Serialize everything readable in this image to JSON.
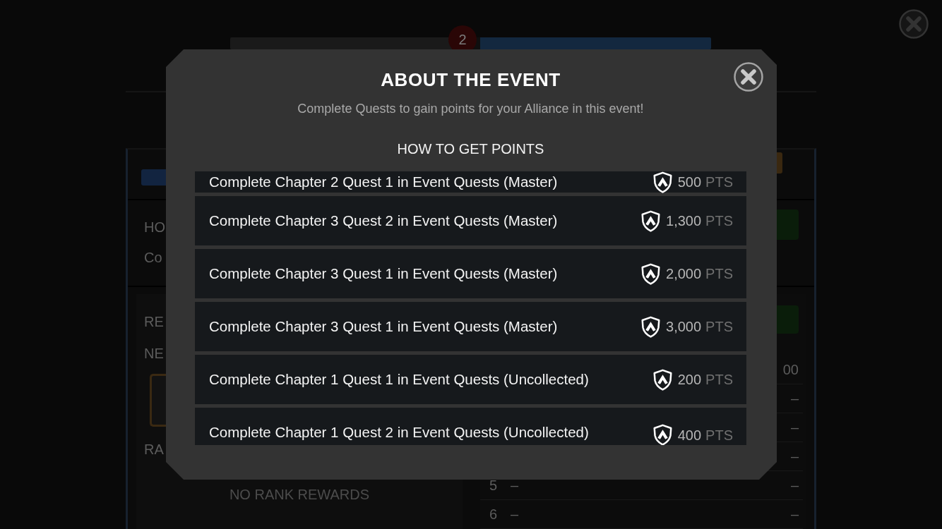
{
  "background": {
    "badge": "2",
    "info": {
      "heading": "HO",
      "text": "Co"
    },
    "rewards": {
      "heading": "RE",
      "next_label": "NE",
      "rank_label": "RA",
      "empty_message": "NO RANK REWARDS"
    },
    "ranking": [
      {
        "value": "00"
      },
      {
        "value": "–"
      },
      {
        "value": "–"
      },
      {
        "value": "–"
      },
      {
        "rank": "5",
        "player": "–",
        "value": "–"
      },
      {
        "rank": "6",
        "player": "–",
        "value": "–"
      }
    ]
  },
  "dialog": {
    "title": "ABOUT THE EVENT",
    "subtitle": "Complete Quests to gain points for your Alliance in this event!",
    "section_title": "HOW TO GET POINTS",
    "tasks": [
      {
        "text": "Complete Chapter 2 Quest 1 in Event Quests (Master)",
        "points": "500",
        "unit": "PTS"
      },
      {
        "text": "Complete Chapter 3 Quest 2 in Event Quests (Master)",
        "points": "1,300",
        "unit": "PTS"
      },
      {
        "text": "Complete Chapter 3 Quest 1 in Event Quests (Master)",
        "points": "2,000",
        "unit": "PTS"
      },
      {
        "text": "Complete Chapter 3 Quest 1 in Event Quests (Master)",
        "points": "3,000",
        "unit": "PTS"
      },
      {
        "text": "Complete Chapter 1 Quest 1 in Event Quests (Uncollected)",
        "points": "200",
        "unit": "PTS"
      },
      {
        "text": "Complete Chapter 1 Quest 2 in Event Quests (Uncollected)",
        "points": "400",
        "unit": "PTS"
      }
    ]
  }
}
